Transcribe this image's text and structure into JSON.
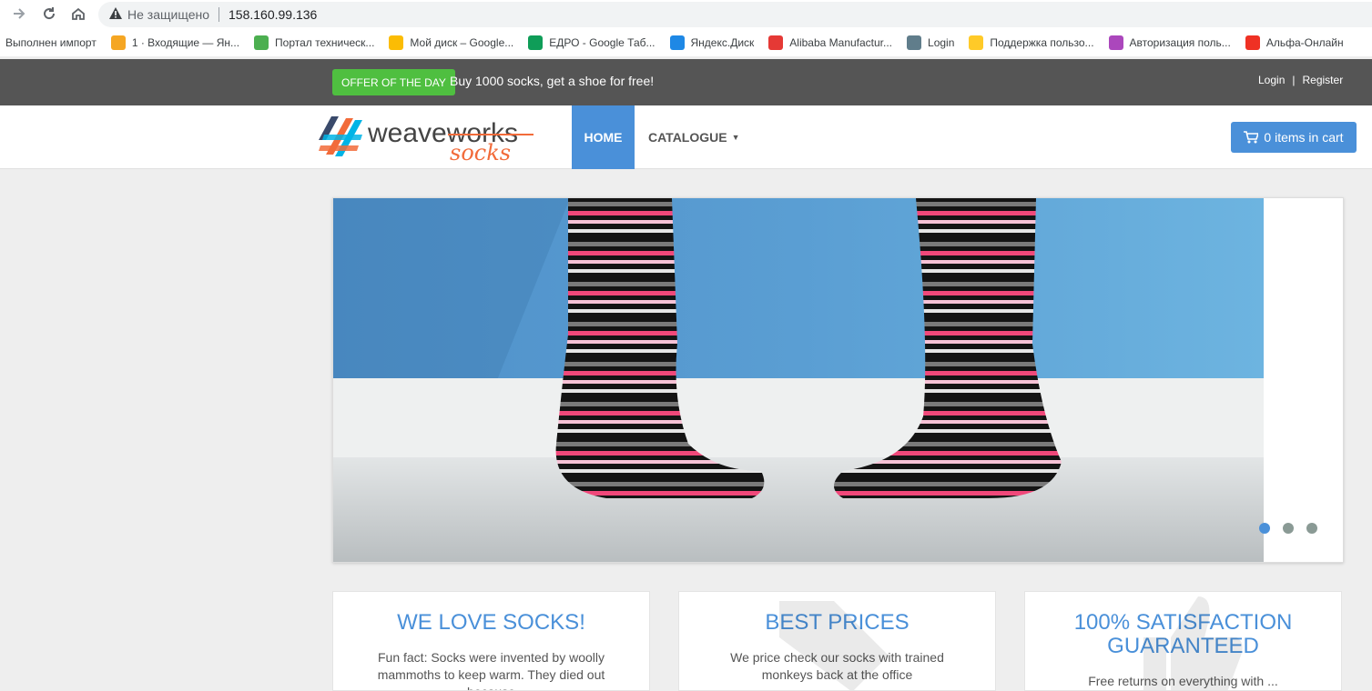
{
  "browser": {
    "security_label": "Не защищено",
    "url": "158.160.99.136",
    "bookmarks": [
      {
        "label": "Выполнен импорт",
        "icon": "none",
        "color": ""
      },
      {
        "label": "1 · Входящие — Ян...",
        "icon": "mail-icon",
        "color": "#f5a623"
      },
      {
        "label": "Портал техническ...",
        "icon": "check-icon",
        "color": "#4caf50"
      },
      {
        "label": "Мой диск – Google...",
        "icon": "drive-icon",
        "color": "#fbbc04"
      },
      {
        "label": "ЕДРО - Google Таб...",
        "icon": "sheets-icon",
        "color": "#0f9d58"
      },
      {
        "label": "Яндекс.Диск",
        "icon": "cloud-icon",
        "color": "#1e88e5"
      },
      {
        "label": "Alibaba Manufactur...",
        "icon": "alibaba-icon",
        "color": "#e53935"
      },
      {
        "label": "Login",
        "icon": "key-icon",
        "color": "#607d8b"
      },
      {
        "label": "Поддержка пользо...",
        "icon": "support-icon",
        "color": "#ffca28"
      },
      {
        "label": "Авторизация поль...",
        "icon": "gear-icon",
        "color": "#ab47bc"
      },
      {
        "label": "Альфа-Онлайн",
        "icon": "alfa-icon",
        "color": "#ef3124"
      }
    ]
  },
  "topbar": {
    "offer_label": "OFFER OF THE DAY",
    "offer_text": "Buy 1000 socks, get a shoe for free!",
    "login": "Login",
    "separator": "|",
    "register": "Register"
  },
  "navbar": {
    "logo_main": "weaveworks",
    "logo_sub": "socks",
    "home": "HOME",
    "catalogue": "CATALOGUE",
    "cart": "0 items in cart",
    "active_color": "#4a90d9"
  },
  "carousel": {
    "slides": 3,
    "active_slide": 1
  },
  "features": [
    {
      "title": "WE LOVE SOCKS!",
      "text": "Fun fact: Socks were invented by woolly mammoths to keep warm. They died out because"
    },
    {
      "title": "BEST PRICES",
      "text": "We price check our socks with trained monkeys back at the office"
    },
    {
      "title": "100% SATISFACTION GUARANTEED",
      "text": "Free returns on everything with ..."
    }
  ]
}
